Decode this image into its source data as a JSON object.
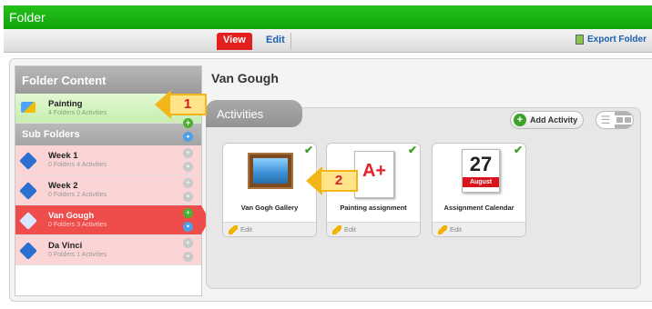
{
  "window": {
    "title": "Folder"
  },
  "toolbar": {
    "view_label": "View",
    "edit_label": "Edit",
    "export_label": "Export Folder"
  },
  "left_panel": {
    "header": "Folder Content",
    "root_folder": {
      "name": "Painting",
      "meta": "4 Folders 0 Activities"
    },
    "subfolders_label": "Sub Folders",
    "subfolders": [
      {
        "name": "Week 1",
        "meta": "0 Folders 4 Activities"
      },
      {
        "name": "Week 2",
        "meta": "0 Folders 2 Activities"
      },
      {
        "name": "Van Gough",
        "meta": "0 Folders 3 Activities"
      },
      {
        "name": "Da Vinci",
        "meta": "0 Folders 1 Activities"
      }
    ]
  },
  "main": {
    "title": "Van Gough",
    "activities_label": "Activities",
    "add_activity_label": "Add Activity",
    "cards": [
      {
        "label": "Van Gogh Gallery",
        "edit": "Edit"
      },
      {
        "label": "Painting assignment",
        "edit": "Edit",
        "icon_text": "A+"
      },
      {
        "label": "Assignment Calendar",
        "edit": "Edit",
        "day": "27",
        "month": "August"
      }
    ]
  },
  "callouts": [
    {
      "number": "1"
    },
    {
      "number": "2"
    }
  ],
  "colors": {
    "titlebar": "#1fb814",
    "selected": "#ef4c4c",
    "accent_red": "#e41f1f",
    "link_blue": "#1e5fb0"
  }
}
